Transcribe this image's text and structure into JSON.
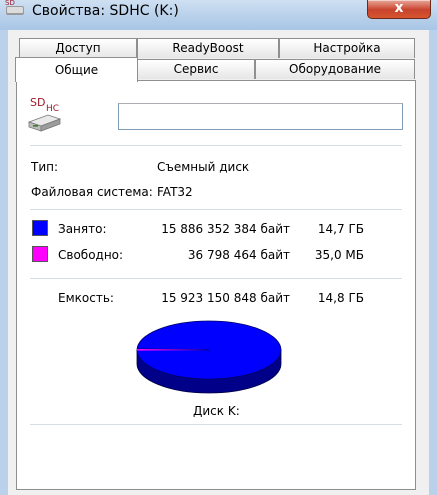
{
  "window": {
    "title": "Свойства: SDHC (K:)",
    "close_glyph": "x"
  },
  "tabs_row1": [
    "Доступ",
    "ReadyBoost",
    "Настройка"
  ],
  "tabs_row2": [
    "Общие",
    "Сервис",
    "Оборудование"
  ],
  "active_tab": "Общие",
  "general": {
    "drive_icon_label": "SDHC",
    "name_value": "",
    "type_label": "Тип:",
    "type_value": "Съемный диск",
    "fs_label": "Файловая система:",
    "fs_value": "FAT32",
    "used_label": "Занято:",
    "used_bytes": "15 886 352 384 байт",
    "used_size": "14,7 ГБ",
    "free_label": "Свободно:",
    "free_bytes": "36 798 464 байт",
    "free_size": "35,0 МБ",
    "capacity_label": "Емкость:",
    "capacity_bytes": "15 923 150 848 байт",
    "capacity_size": "14,8 ГБ",
    "disk_label": "Диск K:"
  },
  "colors": {
    "used": "#0000ff",
    "free": "#ff00ff"
  },
  "icons": {
    "window_icon": "sd-card-icon",
    "drive_icon": "sd-card-drive-icon",
    "close": "close-icon"
  }
}
